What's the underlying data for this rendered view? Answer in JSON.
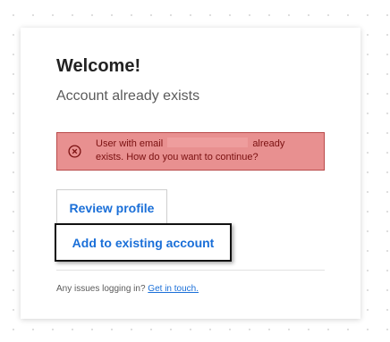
{
  "card": {
    "title": "Welcome!",
    "subtitle": "Account already exists"
  },
  "alert": {
    "icon": "close-circle-icon",
    "text_before": "User with email",
    "text_after": "already",
    "text_line2": "exists. How do you want to continue?",
    "colors": {
      "background": "#e89090",
      "border": "#b94a4a",
      "text": "#7a1010"
    }
  },
  "actions": {
    "review_label": "Review profile",
    "add_label": "Add to existing account"
  },
  "footer": {
    "text": "Any issues logging in?",
    "link_label": "Get in touch."
  },
  "colors": {
    "accent": "#1a6fd8"
  }
}
